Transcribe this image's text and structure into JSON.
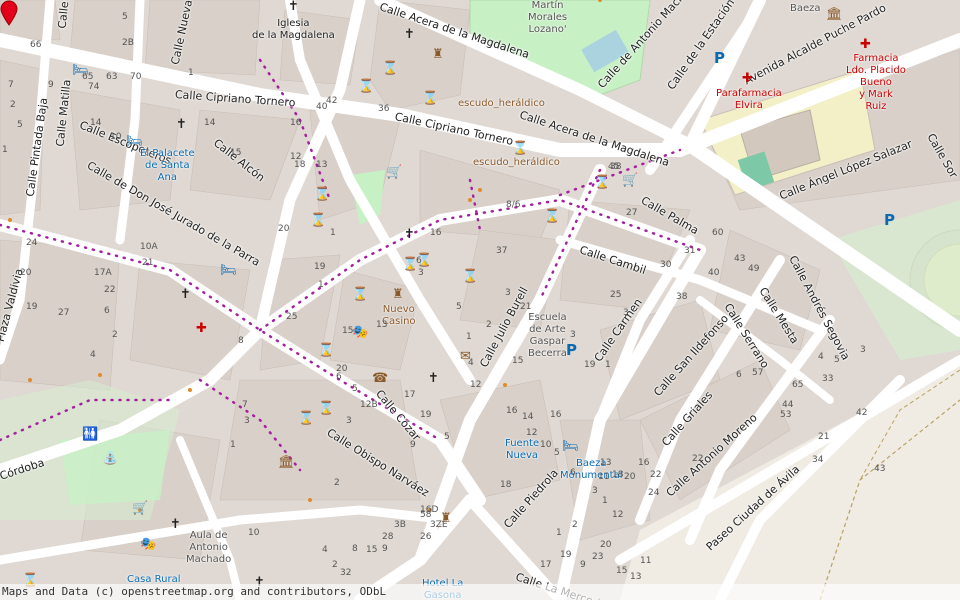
{
  "map": {
    "marker_color": "#e3001b",
    "attribution": "Maps and Data (c) openstreetmap.org and contributors, ODbL",
    "streets": [
      {
        "id": "acera-magdalena-top",
        "label": "Calle Acera de la Magdalena"
      },
      {
        "id": "antonio-machado",
        "label": "Calle de Antonio Machado"
      },
      {
        "id": "estacion",
        "label": "Calle de la Estación"
      },
      {
        "id": "puche-pardo",
        "label": "Avenida Alcalde Puche Pardo"
      },
      {
        "id": "cipriano-tornero-w",
        "label": "Calle Cipriano Tornero"
      },
      {
        "id": "cipriano-tornero-e",
        "label": "Calle Cipriano Tornero"
      },
      {
        "id": "acera-magdalena",
        "label": "Calle Acera de la Magdalena"
      },
      {
        "id": "escopeteros",
        "label": "Calle Escopeteros"
      },
      {
        "id": "pintada-baja",
        "label": "Calle Pintada Baja"
      },
      {
        "id": "matilla",
        "label": "Calle Matilla"
      },
      {
        "id": "nueva",
        "label": "Calle Nueva"
      },
      {
        "id": "alcon",
        "label": "Calle Alcón"
      },
      {
        "id": "jose-jurado",
        "label": "Calle de Don José Jurado de la Parra"
      },
      {
        "id": "angel-lopez",
        "label": "Calle Ángel López Salazar"
      },
      {
        "id": "palma",
        "label": "Calle Palma"
      },
      {
        "id": "cambil",
        "label": "Calle Cambil"
      },
      {
        "id": "julio-burell",
        "label": "Calle Julio Burell"
      },
      {
        "id": "carmen",
        "label": "Calle Carmen"
      },
      {
        "id": "andres-segovia",
        "label": "Calle Andrés Segovia"
      },
      {
        "id": "mesta",
        "label": "Calle Mesta"
      },
      {
        "id": "serrano",
        "label": "Calle Serrano"
      },
      {
        "id": "san-ildefonso",
        "label": "Calle San Ildefonso"
      },
      {
        "id": "griales",
        "label": "Calle Griales"
      },
      {
        "id": "antonio-moreno",
        "label": "Calle Antonio Moreno"
      },
      {
        "id": "ciudad-avila",
        "label": "Paseo Ciudad de Ávila"
      },
      {
        "id": "cozar",
        "label": "Calle Cózar"
      },
      {
        "id": "obispo-narvaez",
        "label": "Calle Obispo Narváez"
      },
      {
        "id": "cordoba",
        "label": "Córdoba"
      },
      {
        "id": "piedrola",
        "label": "Calle Piedrola"
      },
      {
        "id": "merced",
        "label": "Calle La Merced"
      },
      {
        "id": "plaza-valdivia",
        "label": "Plaza Valdivia"
      },
      {
        "id": "calle-w-top",
        "label": "Calle"
      },
      {
        "id": "calle-e-edge",
        "label": "Calle Sor"
      }
    ],
    "pois": [
      {
        "id": "iglesia-magdalena",
        "label": "Iglesia\nde la Magdalena",
        "color": "#222"
      },
      {
        "id": "martin-morales",
        "label": "Martín\nMorales\nLozano'",
        "color": "#555"
      },
      {
        "id": "baeza-top",
        "label": "Baeza",
        "color": "#555"
      },
      {
        "id": "escudo-1",
        "label": "escudo_heráldico",
        "color": "#8a5a2b"
      },
      {
        "id": "escudo-2",
        "label": "escudo_heráldico",
        "color": "#8a5a2b"
      },
      {
        "id": "palacete",
        "label": "El Palacete\nde Santa\nAna",
        "color": "#0a6bb3"
      },
      {
        "id": "parafarmacia",
        "label": "Parafarmacia\nElvira",
        "color": "#c00"
      },
      {
        "id": "farmacia",
        "label": "Farmacia\nLdo. Placido\nBueno\ny Mark\nRuiz",
        "color": "#c00"
      },
      {
        "id": "nuevo-casino",
        "label": "Nuevo\nCasino",
        "color": "#8a5a2b"
      },
      {
        "id": "escuela-arte",
        "label": "Escuela\nde Arte\nGaspar\nBecerra",
        "color": "#555"
      },
      {
        "id": "fuente-nueva",
        "label": "Fuente\nNueva",
        "color": "#0a6bb3"
      },
      {
        "id": "baeza-monumental",
        "label": "Baeza\nMonumental",
        "color": "#0a6bb3"
      },
      {
        "id": "aula-machado",
        "label": "Aula de\nAntonio\nMachado",
        "color": "#555"
      },
      {
        "id": "casa-rural",
        "label": "Casa Rural",
        "color": "#0a6bb3"
      },
      {
        "id": "hotel-la-gasona",
        "label": "Hotel La\nGasona",
        "color": "#0a6bb3"
      }
    ],
    "house_numbers": [
      "66",
      "5",
      "2B",
      "1",
      "63",
      "70",
      "65",
      "74",
      "42",
      "36",
      "40",
      "14",
      "16",
      "15",
      "12",
      "18",
      "13",
      "14",
      "10",
      "7",
      "9",
      "2",
      "5",
      "1",
      "24",
      "20",
      "10A",
      "21",
      "17A",
      "22",
      "27",
      "19",
      "6",
      "4",
      "2",
      "20",
      "25",
      "15",
      "13",
      "8",
      "19",
      "1",
      "1",
      "6",
      "16",
      "3",
      "5",
      "8/6",
      "37",
      "38",
      "27",
      "45",
      "3",
      "21",
      "1",
      "2",
      "4",
      "12",
      "15",
      "16",
      "19",
      "20",
      "6",
      "3",
      "5",
      "12B",
      "17",
      "19",
      "3",
      "1",
      "3",
      "25",
      "38",
      "31",
      "30",
      "60",
      "40",
      "43",
      "49",
      "6",
      "4",
      "5",
      "3",
      "33",
      "57",
      "65",
      "53",
      "44",
      "21",
      "42",
      "43",
      "34",
      "22",
      "16",
      "20",
      "18",
      "11",
      "13",
      "9",
      "5",
      "7",
      "3",
      "1",
      "2",
      "10",
      "8",
      "9",
      "3B",
      "16D",
      "3ZE",
      "58",
      "4",
      "2",
      "32",
      "15",
      "28",
      "26",
      "18",
      "16",
      "14",
      "12",
      "10",
      "5",
      "6",
      "3",
      "1",
      "12",
      "22",
      "24",
      "20",
      "23",
      "19",
      "17",
      "15",
      "13",
      "11",
      "9",
      "2",
      "1",
      "25",
      "13",
      "12",
      "4",
      "6",
      "5",
      "17",
      "3",
      "8",
      "2",
      "3",
      "4"
    ],
    "icons": [
      {
        "id": "church",
        "label": "✝"
      },
      {
        "id": "hourglass",
        "label": "⌛"
      },
      {
        "id": "hotel",
        "label": "🛏"
      },
      {
        "id": "pharmacy",
        "label": "✚"
      },
      {
        "id": "parking",
        "label": "P"
      },
      {
        "id": "shop",
        "label": "🛒"
      },
      {
        "id": "theatre",
        "label": "🎭"
      },
      {
        "id": "post",
        "label": "✉"
      },
      {
        "id": "castle",
        "label": "♜"
      },
      {
        "id": "telephone",
        "label": "☎"
      },
      {
        "id": "museum",
        "label": "🏛"
      },
      {
        "id": "toilets",
        "label": "🚻"
      },
      {
        "id": "fountain",
        "label": "⛲"
      }
    ]
  }
}
